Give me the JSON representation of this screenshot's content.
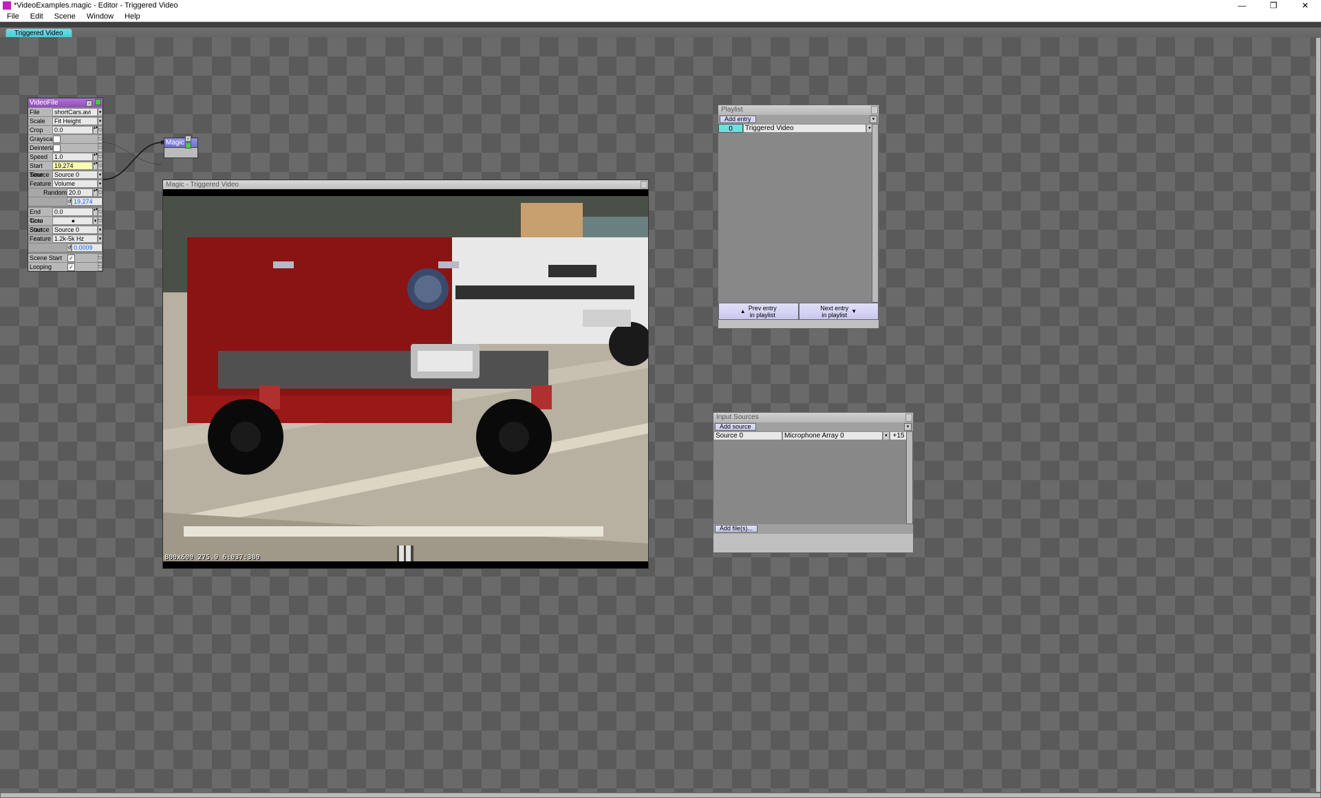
{
  "window": {
    "title": "*VideoExamples.magic - Editor - Triggered Video",
    "menus": [
      "File",
      "Edit",
      "Scene",
      "Window",
      "Help"
    ],
    "minimize": "—",
    "maximize": "❐",
    "close": "✕"
  },
  "tab": {
    "label": "Triggered Video"
  },
  "videoNode": {
    "header": "VideoFile",
    "rows": {
      "file": {
        "label": "File",
        "value": "shortCars.avi"
      },
      "scale": {
        "label": "Scale",
        "value": "Fit Height"
      },
      "crop": {
        "label": "Crop",
        "value": "0.0"
      },
      "grayscale": {
        "label": "Grayscale"
      },
      "deinterlace": {
        "label": "Deinterlace"
      },
      "speed": {
        "label": "Speed",
        "value": "1.0"
      },
      "startTime": {
        "label": "Start Time",
        "value": "19.274"
      },
      "source1": {
        "label": "Source",
        "value": "Source 0"
      },
      "feature1": {
        "label": "Feature",
        "value": "Volume"
      },
      "random": {
        "label": "Random",
        "value": "20.0"
      },
      "randOut": {
        "value": "19.274"
      },
      "endTime": {
        "label": "End Time",
        "value": "0.0"
      },
      "gotoStart": {
        "label": "Goto Start",
        "value": "●"
      },
      "source2": {
        "label": "Source",
        "value": "Source 0"
      },
      "feature2": {
        "label": "Feature",
        "value": "1.2k-5k Hz"
      },
      "featOut": {
        "value": "0.0009"
      },
      "sceneStart": {
        "label": "Scene Start",
        "checked": "✓"
      },
      "looping": {
        "label": "Looping",
        "checked": "✓"
      }
    }
  },
  "magicNode": {
    "header": "Magic"
  },
  "preview": {
    "title": "Magic - Triggered Video",
    "overlay": "800x600 275.9 6:037:380"
  },
  "playlist": {
    "title": "Playlist",
    "addEntry": "Add entry",
    "entries": [
      {
        "index": "0",
        "name": "Triggered Video"
      }
    ],
    "prev": "Prev entry\nin playlist",
    "next": "Next entry\nin playlist"
  },
  "sources": {
    "title": "Input Sources",
    "addSource": "Add source",
    "rows": [
      {
        "name": "Source 0",
        "device": "Microphone Array 0",
        "gain": "+15"
      }
    ],
    "addFiles": "Add file(s)..."
  }
}
